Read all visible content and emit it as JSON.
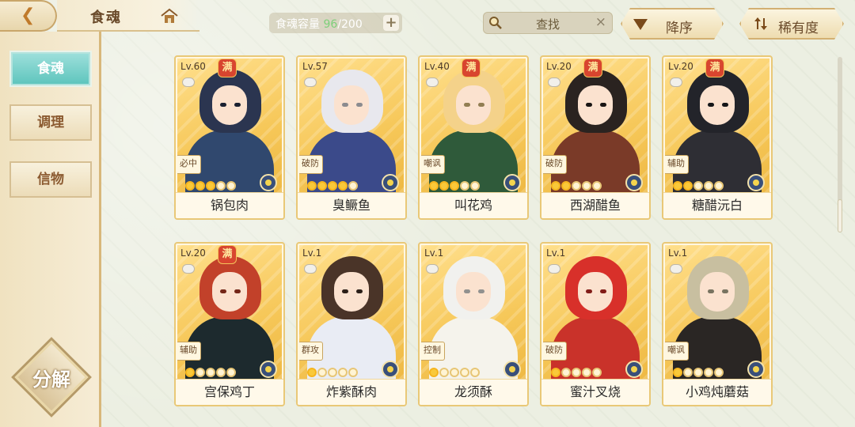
{
  "header": {
    "title": "食魂",
    "capacity_label": "食魂容量",
    "capacity_current": "96",
    "capacity_total": "/200",
    "plus_label": "+",
    "search_placeholder": "查找",
    "search_clear": "×",
    "sort_label": "降序",
    "rarity_label": "稀有度"
  },
  "sidebar": {
    "items": [
      {
        "label": "食魂",
        "active": true
      },
      {
        "label": "调理",
        "active": false
      },
      {
        "label": "信物",
        "active": false
      }
    ],
    "decompose_label": "分解"
  },
  "cards": [
    {
      "level": "Lv.60",
      "maxed": true,
      "full_label": "满",
      "role": "必中",
      "stars": 3,
      "name": "锅包肉",
      "hair": "#2b3550",
      "body": "#30486e"
    },
    {
      "level": "Lv.57",
      "maxed": false,
      "full_label": "",
      "role": "破防",
      "stars": 4,
      "name": "臭鳜鱼",
      "hair": "#e8e8ee",
      "body": "#3b4a8a"
    },
    {
      "level": "Lv.40",
      "maxed": true,
      "full_label": "满",
      "role": "嘲讽",
      "stars": 3,
      "name": "叫花鸡",
      "hair": "#f4d28a",
      "body": "#2f5a3a"
    },
    {
      "level": "Lv.20",
      "maxed": true,
      "full_label": "满",
      "role": "破防",
      "stars": 2,
      "name": "西湖醋鱼",
      "hair": "#2a2320",
      "body": "#7a3a28"
    },
    {
      "level": "Lv.20",
      "maxed": true,
      "full_label": "满",
      "role": "辅助",
      "stars": 2,
      "name": "糖醋沅白",
      "hair": "#23242a",
      "body": "#2e2e34"
    },
    {
      "level": "Lv.20",
      "maxed": true,
      "full_label": "满",
      "role": "辅助",
      "stars": 1,
      "name": "宫保鸡丁",
      "hair": "#c2412a",
      "body": "#1d2a2e"
    },
    {
      "level": "Lv.1",
      "maxed": false,
      "full_label": "",
      "role": "群攻",
      "stars": 1,
      "name": "炸紫酥肉",
      "hair": "#4a3428",
      "body": "#e9ecf4"
    },
    {
      "level": "Lv.1",
      "maxed": false,
      "full_label": "",
      "role": "控制",
      "stars": 1,
      "name": "龙须酥",
      "hair": "#f1f1ee",
      "body": "#f5f3ec"
    },
    {
      "level": "Lv.1",
      "maxed": false,
      "full_label": "",
      "role": "破防",
      "stars": 1,
      "name": "蜜汁叉烧",
      "hair": "#d8302a",
      "body": "#c9322a"
    },
    {
      "level": "Lv.1",
      "maxed": false,
      "full_label": "",
      "role": "嘲讽",
      "stars": 1,
      "name": "小鸡炖蘑菇",
      "hair": "#c8bfa0",
      "body": "#2a2624"
    }
  ],
  "colors": {
    "accent_teal": "#5cc4bc",
    "gold_border": "#e9c877",
    "capacity_green": "#7ed07a"
  }
}
